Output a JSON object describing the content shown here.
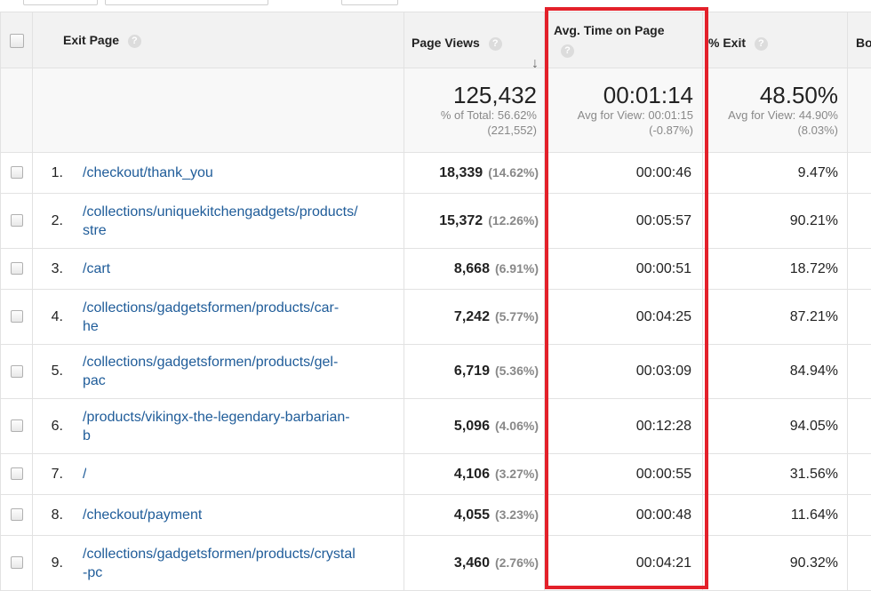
{
  "header": {
    "exit_page": "Exit Page",
    "page_views": "Page Views",
    "avg_time": "Avg. Time on Page",
    "exit_pct": "% Exit",
    "bounce": "Bo",
    "help": "?"
  },
  "totals": {
    "page_views": "125,432",
    "page_views_sub1": "% of Total: 56.62%",
    "page_views_sub2": "(221,552)",
    "avg_time": "00:01:14",
    "avg_time_sub1": "Avg for View: 00:01:15",
    "avg_time_sub2": "(-0.87%)",
    "exit_pct": "48.50%",
    "exit_sub1": "Avg for View: 44.90%",
    "exit_sub2": "(8.03%)"
  },
  "rows": [
    {
      "idx": "1.",
      "line1": "/checkout/thank_you",
      "line2": "",
      "views": "18,339",
      "views_pct": "(14.62%)",
      "time": "00:00:46",
      "exit": "9.47%"
    },
    {
      "idx": "2.",
      "line1": "/collections/uniquekitchengadgets/products/",
      "line2": "stre",
      "views": "15,372",
      "views_pct": "(12.26%)",
      "time": "00:05:57",
      "exit": "90.21%"
    },
    {
      "idx": "3.",
      "line1": "/cart",
      "line2": "",
      "views": "8,668",
      "views_pct": "(6.91%)",
      "time": "00:00:51",
      "exit": "18.72%"
    },
    {
      "idx": "4.",
      "line1": "/collections/gadgetsformen/products/car-",
      "line2": "he",
      "views": "7,242",
      "views_pct": "(5.77%)",
      "time": "00:04:25",
      "exit": "87.21%"
    },
    {
      "idx": "5.",
      "line1": "/collections/gadgetsformen/products/gel-",
      "line2": "pac",
      "views": "6,719",
      "views_pct": "(5.36%)",
      "time": "00:03:09",
      "exit": "84.94%"
    },
    {
      "idx": "6.",
      "line1": "/products/vikingx-the-legendary-barbarian-",
      "line2": "b",
      "views": "5,096",
      "views_pct": "(4.06%)",
      "time": "00:12:28",
      "exit": "94.05%"
    },
    {
      "idx": "7.",
      "line1": "/",
      "line2": "",
      "views": "4,106",
      "views_pct": "(3.27%)",
      "time": "00:00:55",
      "exit": "31.56%"
    },
    {
      "idx": "8.",
      "line1": "/checkout/payment",
      "line2": "",
      "views": "4,055",
      "views_pct": "(3.23%)",
      "time": "00:00:48",
      "exit": "11.64%"
    },
    {
      "idx": "9.",
      "line1": "/collections/gadgetsformen/products/crystal",
      "line2": "-pc",
      "views": "3,460",
      "views_pct": "(2.76%)",
      "time": "00:04:21",
      "exit": "90.32%"
    }
  ],
  "colors": {
    "link": "#1f5c99",
    "highlight": "#e3202a",
    "header_bg": "#f2f2f2"
  }
}
